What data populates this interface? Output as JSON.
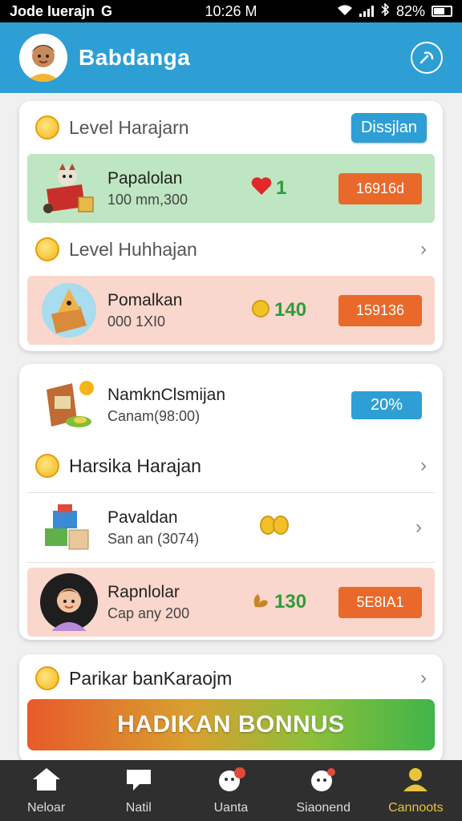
{
  "status_bar": {
    "carrier": "Jode Iuerajn",
    "app_icon": "G",
    "time": "10:26 M",
    "battery": "82%"
  },
  "header": {
    "title": "Babdanga"
  },
  "card1": {
    "level1": {
      "label": "Level Harajarn",
      "button": "Dissjlan"
    },
    "item1": {
      "name": "Papalolan",
      "sub": "100 mm,300",
      "reward": "1",
      "button": "16916d"
    },
    "level2": {
      "label": "Level Huhhajan"
    },
    "item2": {
      "name": "Pomalkan",
      "sub": "000 1XI0",
      "reward": "140",
      "button": "159136"
    }
  },
  "card2": {
    "item1": {
      "name": "NamknClsmijan",
      "sub": "Canam(98:00)",
      "button": "20%"
    },
    "level": {
      "label": "Harsika Harajan"
    },
    "item2": {
      "name": "Pavaldan",
      "sub": "San an (3074)",
      "reward": ""
    },
    "item3": {
      "name": "Rapnlolar",
      "sub": "Cap any 200",
      "reward": "130",
      "button": "5E8IA1"
    }
  },
  "card3": {
    "level": {
      "label": "Parikar banKaraojm"
    },
    "bonus": "HADIKAN BONNUS"
  },
  "nav": [
    {
      "label": "Neloar",
      "icon": "home-icon"
    },
    {
      "label": "Natil",
      "icon": "chat-icon"
    },
    {
      "label": "Uanta",
      "icon": "game-icon"
    },
    {
      "label": "Siaonend",
      "icon": "pet-icon"
    },
    {
      "label": "Cannoots",
      "icon": "profile-icon"
    }
  ],
  "colors": {
    "primary": "#2e9fd4",
    "orange": "#e8692a",
    "green_row": "#bfe6c2",
    "pink_row": "#fad7cc",
    "active_nav": "#e8c43b"
  }
}
